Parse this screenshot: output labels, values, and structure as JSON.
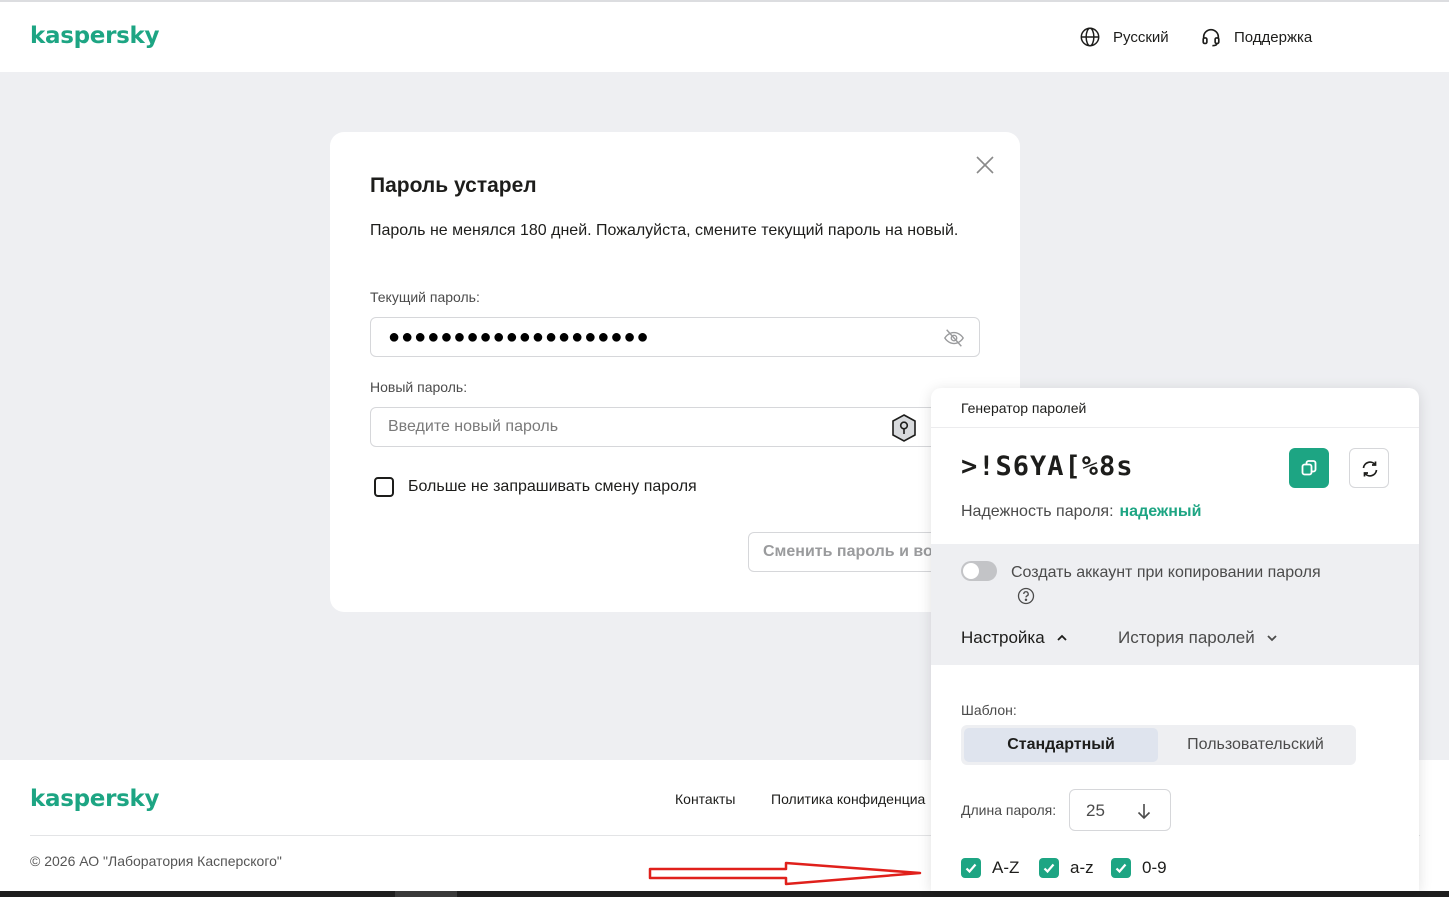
{
  "brand": {
    "logo": "kaspersky",
    "accent": "#1da583"
  },
  "header": {
    "language": "Русский",
    "support": "Поддержка"
  },
  "dialog": {
    "title": "Пароль устарел",
    "message": "Пароль не менялся 180 дней. Пожалуйста, смените текущий пароль на новый.",
    "current_label": "Текущий пароль:",
    "current_value": "●●●●●●●●●●●●●●●●●●●●",
    "new_label": "Новый пароль:",
    "new_placeholder": "Введите новый пароль",
    "dont_ask": "Больше не запрашивать смену пароля",
    "submit": "Сменить пароль и во"
  },
  "generator": {
    "title": "Генератор паролей",
    "password": ">!S6YA[%8s",
    "strength_label": "Надежность пароля:",
    "strength_value": "надежный",
    "create_account": "Создать аккаунт при копировании пароля",
    "tab_settings": "Настройка",
    "tab_history": "История паролей",
    "template_label": "Шаблон:",
    "template_standard": "Стандартный",
    "template_custom": "Пользовательский",
    "length_label": "Длина пароля:",
    "length_value": "25",
    "options": [
      "A-Z",
      "a-z",
      "0-9"
    ]
  },
  "footer": {
    "contacts": "Контакты",
    "privacy": "Политика конфиденциа",
    "copyright": "© 2026 АО \"Лаборатория Касперского\""
  }
}
